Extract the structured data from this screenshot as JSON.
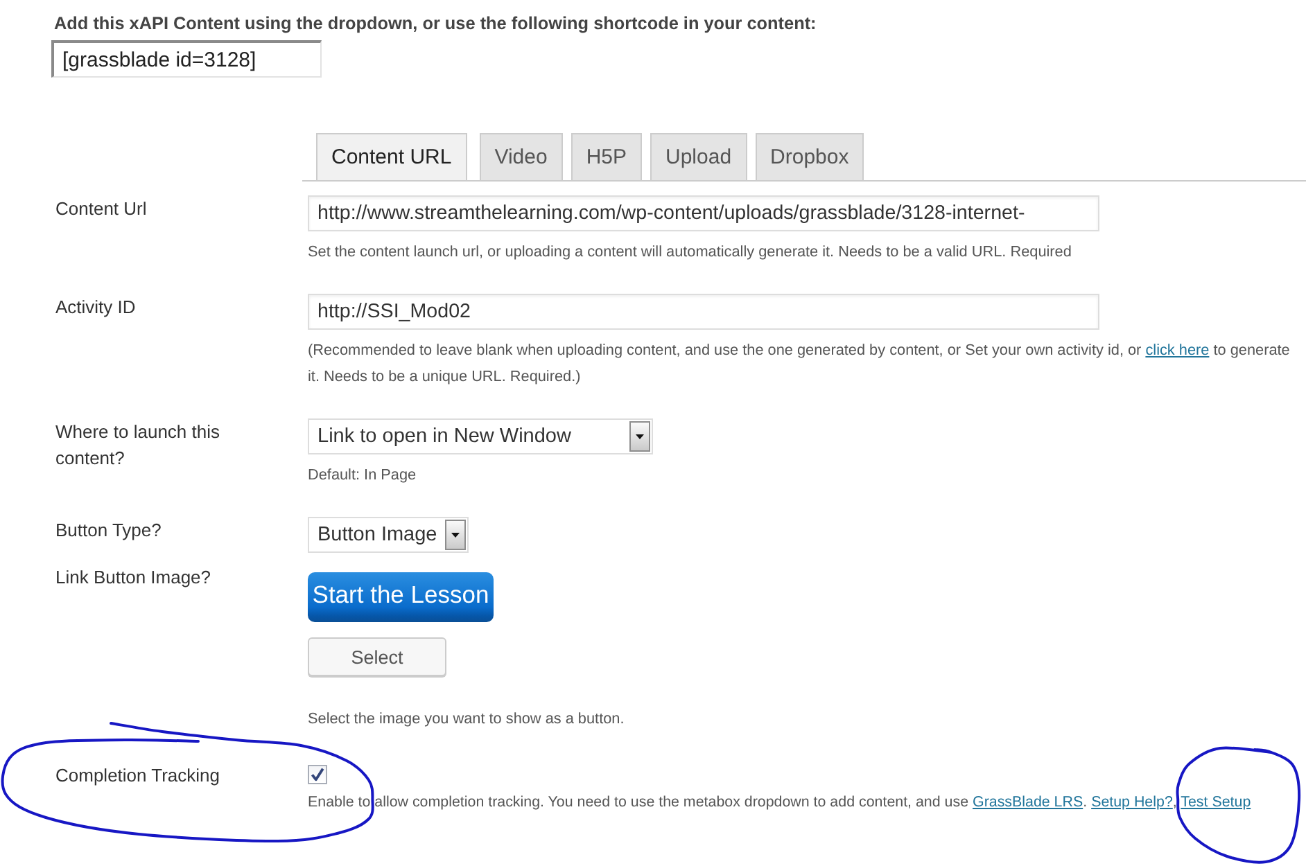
{
  "intro": {
    "text": "Add this xAPI Content using the dropdown, or use the following shortcode in your content:",
    "shortcode": "[grassblade id=3128]"
  },
  "tabs": [
    {
      "label": "Content URL",
      "selected": true
    },
    {
      "label": "Video",
      "selected": false
    },
    {
      "label": "H5P",
      "selected": false
    },
    {
      "label": "Upload",
      "selected": false
    },
    {
      "label": "Dropbox",
      "selected": false
    }
  ],
  "fields": [
    {
      "kind": "text",
      "label": "Content Url",
      "value": "http://www.streamthelearning.com/wp-content/uploads/grassblade/3128-internet-",
      "help": [
        {
          "kind": "text",
          "text": "Set the content launch url, or uploading a content will automatically generate it. Needs to be a valid URL. Required"
        }
      ]
    },
    {
      "kind": "text",
      "label": "Activity ID",
      "value": "http://SSI_Mod02",
      "help": [
        {
          "kind": "text",
          "text": "(Recommended to leave blank when uploading content, and use the one generated by content, or Set your own activity id, or "
        },
        {
          "kind": "link",
          "text": "click here"
        },
        {
          "kind": "text",
          "text": " to generate it. Needs to be a unique URL. Required.)"
        }
      ]
    },
    {
      "kind": "select",
      "label": "Where to launch this content?",
      "value": "Link to open in New Window",
      "help": [
        {
          "kind": "text",
          "text": "Default: In Page"
        }
      ]
    },
    {
      "kind": "select",
      "label": "Button Type?",
      "value": "Button Image"
    },
    {
      "kind": "image",
      "label": "Link Button Image?",
      "image_text": "Start the Lesson",
      "button": "Select",
      "help": [
        {
          "kind": "text",
          "text": "Select the image you want to show as a button."
        }
      ]
    },
    {
      "kind": "checkbox",
      "label": "Completion Tracking",
      "checked": true,
      "help": [
        {
          "kind": "text",
          "text": "Enable to allow completion tracking. You need to use the metabox dropdown to add content, and use "
        },
        {
          "kind": "link",
          "text": "GrassBlade LRS"
        },
        {
          "kind": "text",
          "text": ". "
        },
        {
          "kind": "link",
          "text": "Setup Help?"
        },
        {
          "kind": "text",
          "text": ", "
        },
        {
          "kind": "link",
          "text": "Test Setup"
        }
      ]
    }
  ]
}
